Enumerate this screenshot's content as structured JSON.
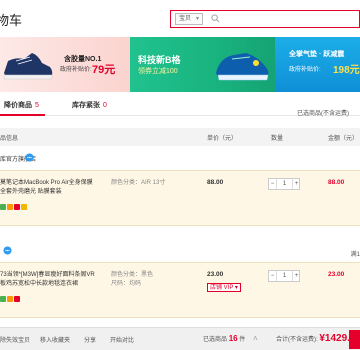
{
  "header": {
    "title": "物车",
    "search_category": "宝贝",
    "search_placeholder": ""
  },
  "banner": {
    "left_line1": "含胶量NO.1",
    "left_line2": "政府补贴价:",
    "left_price": "79元",
    "mid_line1": "科技新B格",
    "mid_line2": "领券立减100",
    "right_line1": "全掌气垫 · 跃减震",
    "right_line2": "政府补贴价:",
    "right_price": "198元"
  },
  "tabs": [
    {
      "label": "降价商品",
      "count": "5"
    },
    {
      "label": "库存紧张",
      "count": "0"
    }
  ],
  "selected_note": "已选商品(不含运费)",
  "columns": {
    "info": "品信息",
    "price": "单价（元）",
    "qty": "数量",
    "amount": "金额（元）"
  },
  "shops": [
    {
      "name": "库官方旗舰店"
    },
    {
      "name": "",
      "more": "满1"
    }
  ],
  "items": [
    {
      "title": "莫笔记本MacBook Pro Air全身保膜 全套外壳磨光 贴膜套装",
      "attr1": "颜色分类：AIR 13寸",
      "attr2": "",
      "price": "88.00",
      "qty": "1",
      "amount": "88.00",
      "vip": ""
    },
    {
      "title": "73当领*[M3W]春显瘦好面料条阁VR板鸡苏宽松中长款地毯连衣裙",
      "attr1": "颜色分类：黑色",
      "attr2": "尺码：均码",
      "price": "23.00",
      "qty": "1",
      "amount": "23.00",
      "vip": "店铺 VIP"
    }
  ],
  "footer": {
    "select_all": "除失效宝贝",
    "move_fav": "移入收藏夹",
    "share": "分享",
    "open_cart": "开始对比",
    "selected_label": "已选商品",
    "selected_count": "16",
    "selected_unit": "件",
    "total_label": "合计(不含运费):",
    "total_amount": "¥1429."
  },
  "colors": {
    "accent": "#e4002b",
    "item_bg": "#fff7e6"
  }
}
